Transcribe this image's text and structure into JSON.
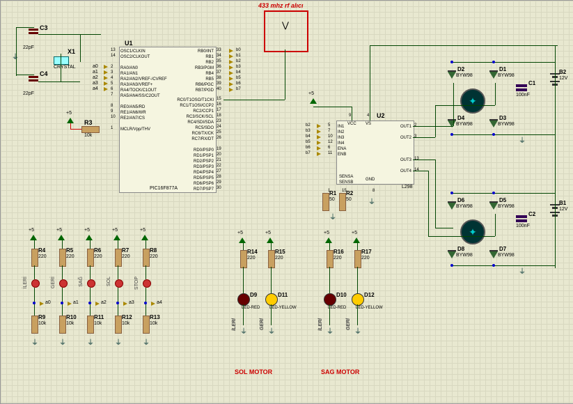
{
  "rf_module": {
    "label": "433 mhz rf alıcı"
  },
  "u1": {
    "ref": "U1",
    "part": "PIC16F877A",
    "left_pins": [
      "OSC1/CLKIN",
      "OSC2/CLKOUT",
      "",
      "RA0/AN0",
      "RA1/AN1",
      "RA2/AN2/VREF-/CVREF",
      "RA3/AN3/VREF+",
      "RA4/TOCK/C1OUT",
      "RA5/AN4/SS/C2OUT",
      "",
      "RE0/AN5/RD",
      "RE1/AN6/WR",
      "RE2/AN7/CS",
      "",
      "MCLR/Vpp/THV"
    ],
    "left_nums": [
      "13",
      "14",
      "",
      "2",
      "3",
      "4",
      "5",
      "6",
      "7",
      "",
      "8",
      "9",
      "10",
      "",
      "1"
    ],
    "right_top_pins": [
      "RB0/INT",
      "RB1",
      "RB2",
      "RB3/PGM",
      "RB4",
      "RB5",
      "RB6/PGC",
      "RB7/PGD"
    ],
    "right_top_nums": [
      "33",
      "34",
      "35",
      "36",
      "37",
      "38",
      "39",
      "40"
    ],
    "right_mid_pins": [
      "RC0/T1OSO/T1CKI",
      "RC1/T1OSI/CCP2",
      "RC2/CCP1",
      "RC3/SCK/SCL",
      "RC4/SDI/SDA",
      "RC5/SDO",
      "RC6/TX/CK",
      "RC7/RX/DT"
    ],
    "right_mid_nums": [
      "15",
      "16",
      "17",
      "18",
      "23",
      "24",
      "25",
      "26"
    ],
    "right_bot_pins": [
      "RD0/PSP0",
      "RD1/PSP1",
      "RD2/PSP2",
      "RD3/PSP3",
      "RD4/PSP4",
      "RD5/PSP5",
      "RD6/PSP6",
      "RD7/PSP7"
    ],
    "right_bot_nums": [
      "19",
      "20",
      "21",
      "22",
      "27",
      "28",
      "29",
      "30"
    ],
    "left_nets": [
      "a0",
      "a1",
      "a2",
      "a3",
      "a4"
    ],
    "rb_nets": [
      "b0",
      "b1",
      "b2",
      "b3",
      "b4",
      "b5",
      "b6",
      "b7"
    ]
  },
  "u2": {
    "ref": "U2",
    "part": "L298",
    "left_pins": [
      "IN1",
      "IN2",
      "IN3",
      "IN4",
      "ENA",
      "ENB"
    ],
    "left_nums": [
      "5",
      "7",
      "10",
      "12",
      "6",
      "11"
    ],
    "top": [
      "VCC",
      "VS"
    ],
    "top_nums": [
      "9",
      "4"
    ],
    "right_pins": [
      "OUT1",
      "OUT2",
      "OUT3",
      "OUT4"
    ],
    "right_nums": [
      "2",
      "3",
      "13",
      "14"
    ],
    "bot": [
      "SENSA",
      "SENSB",
      "GND"
    ],
    "bot_nums": [
      "1",
      "15",
      "8"
    ],
    "left_nets": [
      "b2",
      "b3",
      "b4",
      "b5",
      "b6",
      "b7"
    ]
  },
  "caps": {
    "C1": {
      "ref": "C1",
      "val": "100nF"
    },
    "C2": {
      "ref": "C2",
      "val": "100nF"
    },
    "C3": {
      "ref": "C3",
      "val": "22pF"
    },
    "C4": {
      "ref": "C4",
      "val": "22pF"
    }
  },
  "crystal": {
    "ref": "X1",
    "val": "CRYSTAL"
  },
  "resistors": {
    "R1": {
      "ref": "R1",
      "val": "50"
    },
    "R2": {
      "ref": "R2",
      "val": "50"
    },
    "R3": {
      "ref": "R3",
      "val": "10k"
    },
    "R4": {
      "ref": "R4",
      "val": "220"
    },
    "R5": {
      "ref": "R5",
      "val": "220"
    },
    "R6": {
      "ref": "R6",
      "val": "220"
    },
    "R7": {
      "ref": "R7",
      "val": "220"
    },
    "R8": {
      "ref": "R8",
      "val": "220"
    },
    "R9": {
      "ref": "R9",
      "val": "10k"
    },
    "R10": {
      "ref": "R10",
      "val": "10k"
    },
    "R11": {
      "ref": "R11",
      "val": "10k"
    },
    "R12": {
      "ref": "R12",
      "val": "10k"
    },
    "R13": {
      "ref": "R13",
      "val": "10k"
    },
    "R14": {
      "ref": "R14",
      "val": "220"
    },
    "R15": {
      "ref": "R15",
      "val": "220"
    },
    "R16": {
      "ref": "R16",
      "val": "220"
    },
    "R17": {
      "ref": "R17",
      "val": "220"
    }
  },
  "diodes": {
    "D1": {
      "ref": "D1",
      "val": "BYW98"
    },
    "D2": {
      "ref": "D2",
      "val": "BYW98"
    },
    "D3": {
      "ref": "D3",
      "val": "BYW98"
    },
    "D4": {
      "ref": "D4",
      "val": "BYW98"
    },
    "D5": {
      "ref": "D5",
      "val": "BYW98"
    },
    "D6": {
      "ref": "D6",
      "val": "BYW98"
    },
    "D7": {
      "ref": "D7",
      "val": "BYW98"
    },
    "D8": {
      "ref": "D8",
      "val": "BYW98"
    },
    "D9": {
      "ref": "D9",
      "val": "LED-RED"
    },
    "D10": {
      "ref": "D10",
      "val": "LED-RED"
    },
    "D11": {
      "ref": "D11",
      "val": "LED-YELLOW"
    },
    "D12": {
      "ref": "D12",
      "val": "LED-YELLOW"
    }
  },
  "batteries": {
    "B1": {
      "ref": "B1",
      "val": "12V"
    },
    "B2": {
      "ref": "B2",
      "val": "12V"
    }
  },
  "buttons": [
    "İLERİ",
    "GERİ",
    "SAĞ",
    "SOL",
    "STOP"
  ],
  "button_nets": [
    "a0",
    "a1",
    "a2",
    "a3",
    "a4"
  ],
  "motors": {
    "sol": "SOL MOTOR",
    "sag": "SAG MOTOR"
  },
  "led_labels": {
    "ileri": "İLERİ",
    "geri": "GERİ"
  },
  "vcc5": "+5"
}
